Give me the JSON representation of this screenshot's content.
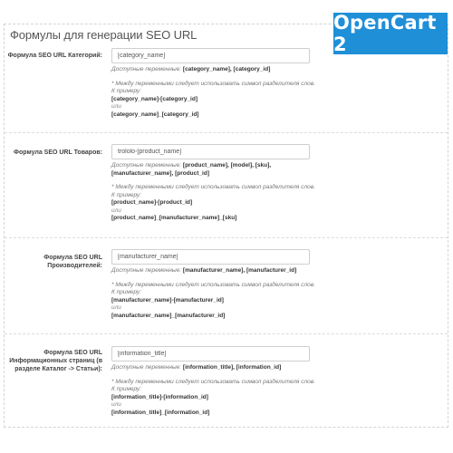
{
  "header": {
    "section_title": "Формулы для генерации SEO URL",
    "badge": "OpenCart 2"
  },
  "rows": [
    {
      "label": "Формула SEO URL Категорий:",
      "value": "[category_name]",
      "vars_prefix": "Доступные переменные: ",
      "vars": "[category_name], [category_id]",
      "note": "* Между переменными следует использовать символ разделителя слов.",
      "example_title": "К примеру:",
      "example1": "[category_name]-[category_id]",
      "or": "или",
      "example2": "[category_name]_[category_id]"
    },
    {
      "label": "Формула SEO URL Товаров:",
      "value": "trololo-[product_name]",
      "vars_prefix": "Доступные переменные: ",
      "vars": "[product_name], [model], [sku], [manufacturer_name], [product_id]",
      "note": "* Между переменными следует использовать символ разделителя слов.",
      "example_title": "К примеру:",
      "example1": "[product_name]-[product_id]",
      "or": "или",
      "example2": "[product_name]_[manufacturer_name]_[sku]"
    },
    {
      "label": "Формула SEO URL Производителей:",
      "value": "[manufacturer_name]",
      "vars_prefix": "Доступные переменные: ",
      "vars": "[manufacturer_name], [manufacturer_id]",
      "note": "* Между переменными следует использовать символ разделителя слов.",
      "example_title": "К примеру:",
      "example1": "[manufacturer_name]-[manufacturer_id]",
      "or": "или",
      "example2": "[manufacturer_name]_[manufacturer_id]"
    },
    {
      "label": "Формула SEO URL Информационных страниц (в разделе Каталог -> Статьи):",
      "value": "[information_title]",
      "vars_prefix": "Доступные переменные: ",
      "vars": "[information_title], [information_id]",
      "note": "* Между переменными следует использовать символ разделителя слов.",
      "example_title": "К примеру:",
      "example1": "[information_title]-[information_id]",
      "or": "или",
      "example2": "[information_title]_[information_id]"
    }
  ]
}
